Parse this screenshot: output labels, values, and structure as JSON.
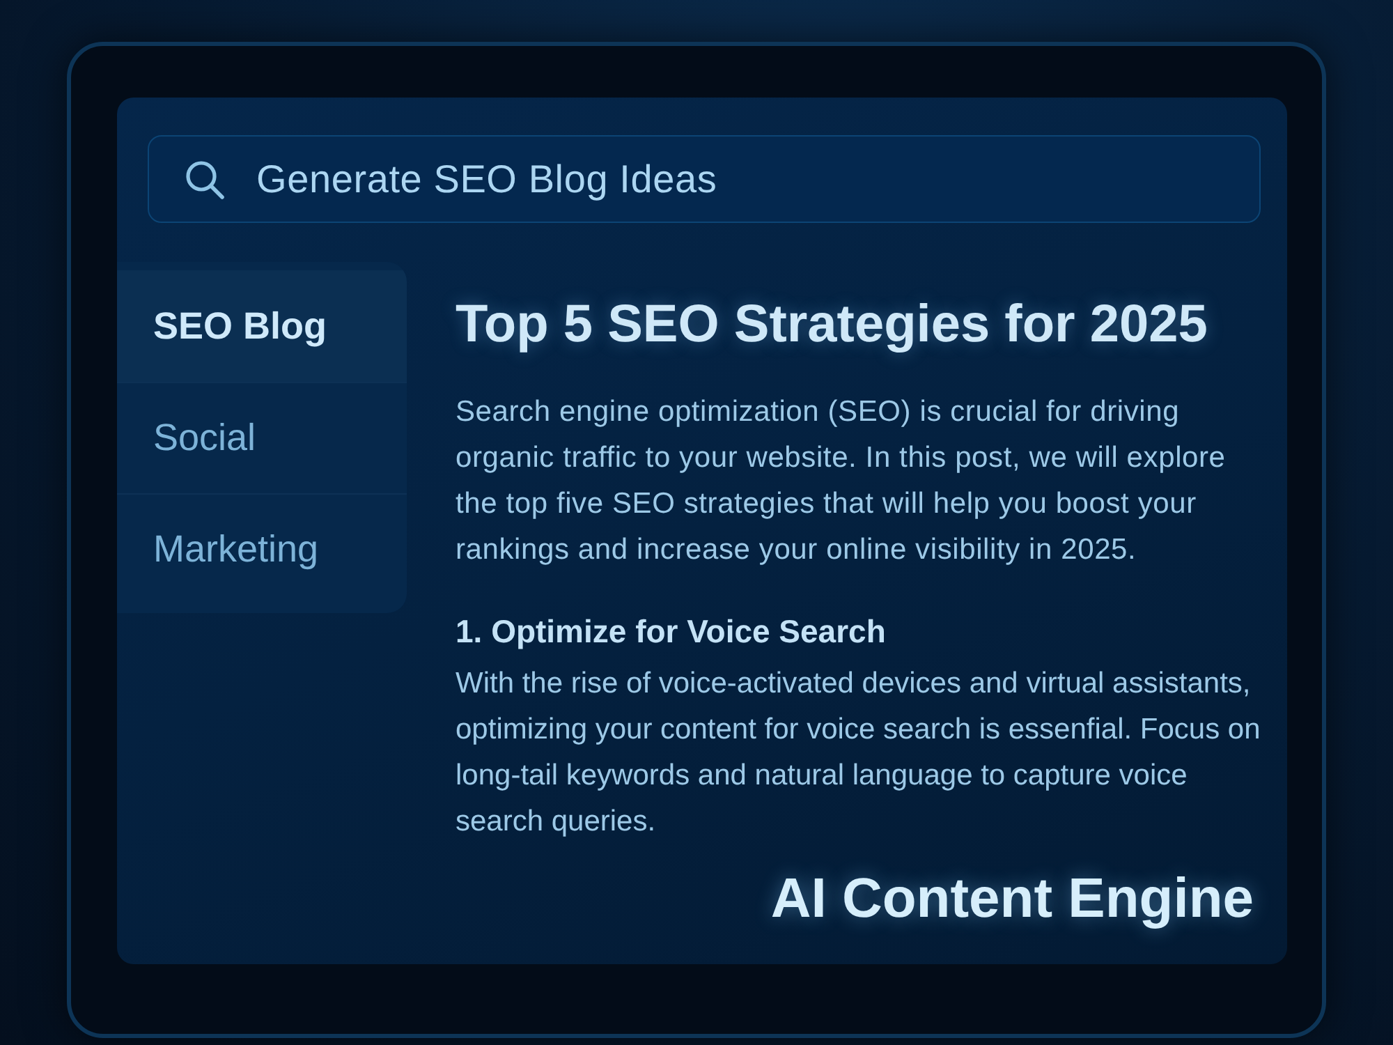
{
  "search": {
    "value": "Generate SEO Blog Ideas"
  },
  "sidebar": {
    "items": [
      {
        "label": "SEO Blog",
        "selected": true
      },
      {
        "label": "Social",
        "selected": false
      },
      {
        "label": "Marketing",
        "selected": false
      }
    ]
  },
  "article": {
    "title": "Top 5 SEO Strategies for 2025",
    "intro": "Search engine optimization (SEO) is crucial for driving organic traffic to your website. In this post, we will explore the top five SEO strategies that will help you boost your rankings and increase your online visibility in 2025.",
    "sections": [
      {
        "heading": "1. Optimize for Voice Search",
        "body": "With the rise of voice-activated devices and virtual assistants, optimizing your content for voice search is essenfial. Focus on long-tail keywords and natural language to capture voice search queries."
      }
    ]
  },
  "brand": {
    "name": "AI Content Engine"
  }
}
